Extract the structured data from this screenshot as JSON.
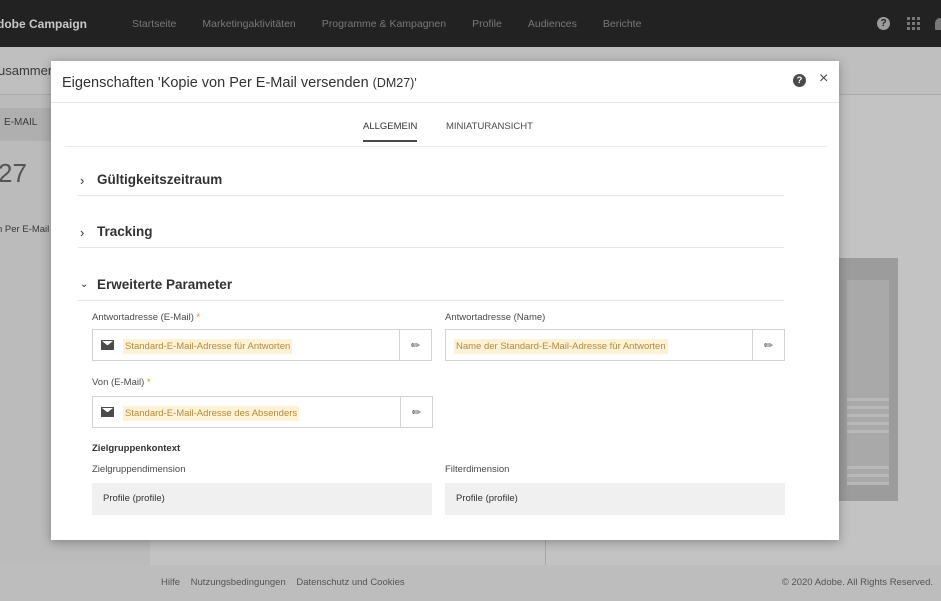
{
  "app": {
    "brand": "dobe Campaign",
    "nav": [
      "Startseite",
      "Marketingaktivitäten",
      "Programme & Kampagnen",
      "Profile",
      "Audiences",
      "Berichte"
    ]
  },
  "background": {
    "subtitle": "usammen",
    "tab_label": "E-MAIL",
    "number": "27",
    "item_label": "n Per E-Mail",
    "footer_links": [
      "Hilfe",
      "Nutzungsbedingungen",
      "Datenschutz und Cookies"
    ],
    "copyright": "© 2020 Adobe. All Rights Reserved."
  },
  "modal": {
    "title_prefix": "Eigenschaften 'Kopie von Per E-Mail versenden ",
    "title_code": "(DM27)'",
    "help": "?",
    "close": "×",
    "tabs": [
      {
        "label": "ALLGEMEIN",
        "active": true
      },
      {
        "label": "MINIATURANSICHT",
        "active": false
      }
    ],
    "sections": [
      {
        "title": "Gültigkeitszeitraum",
        "expanded": false
      },
      {
        "title": "Tracking",
        "expanded": false
      },
      {
        "title": "Erweiterte Parameter",
        "expanded": true
      }
    ],
    "fields": {
      "reply_email": {
        "label": "Antwortadresse (E-Mail)",
        "required": "*",
        "placeholder": "Standard-E-Mail-Adresse für Antworten"
      },
      "reply_name": {
        "label": "Antwortadresse (Name)",
        "placeholder": "Name der Standard-E-Mail-Adresse für Antworten"
      },
      "from_email": {
        "label": "Von (E-Mail)",
        "required": "*",
        "placeholder": "Standard-E-Mail-Adresse des Absenders"
      }
    },
    "target_context": {
      "heading": "Zielgruppenkontext",
      "dimension_label": "Zielgruppendimension",
      "dimension_value": "Profile (profile)",
      "filter_label": "Filterdimension",
      "filter_value": "Profile (profile)"
    }
  }
}
